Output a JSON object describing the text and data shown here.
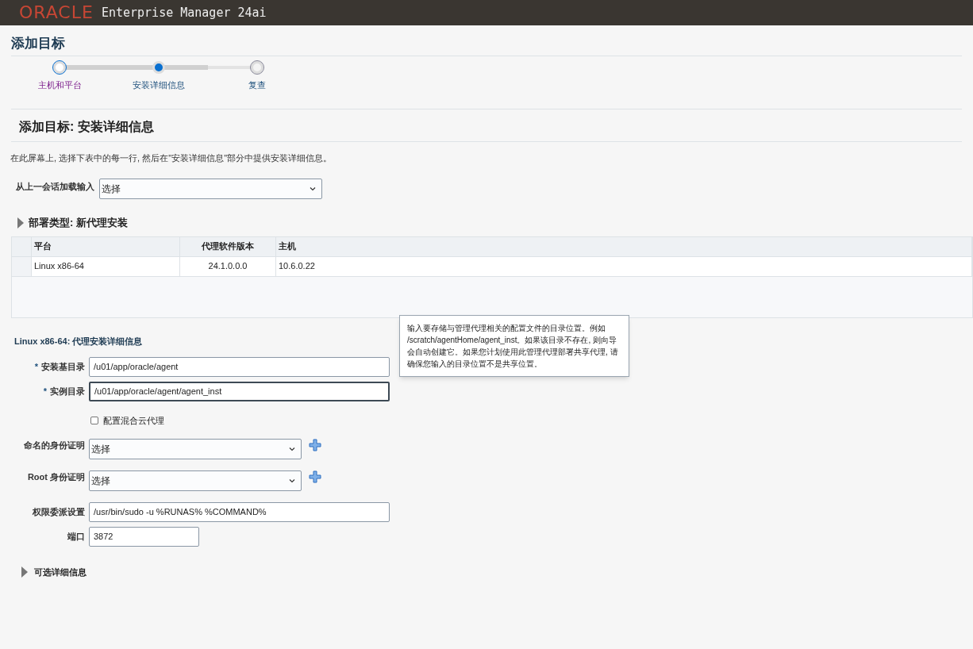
{
  "header": {
    "logo": "ORACLE",
    "product": "Enterprise Manager 24ai"
  },
  "page_title": "添加目标",
  "train": [
    {
      "label": "主机和平台",
      "selected": false,
      "visited": true
    },
    {
      "label": "安装详细信息",
      "selected": true,
      "visited": false
    },
    {
      "label": "复查",
      "selected": false,
      "visited": false
    }
  ],
  "section_title": "添加目标: 安装详细信息",
  "instructions": "在此屏幕上, 选择下表中的每一行, 然后在\"安装详细信息\"部分中提供安装详细信息。",
  "load_input": {
    "label": "从上一会话加载输入",
    "value": "选择"
  },
  "deployment": {
    "title": "部署类型: 新代理安装",
    "expanded": false
  },
  "table": {
    "columns": [
      "平台",
      "代理软件版本",
      "主机"
    ],
    "rows": [
      [
        "Linux x86-64",
        "24.1.0.0.0",
        "10.6.0.22"
      ]
    ]
  },
  "details_title": "Linux x86-64: 代理安装详细信息",
  "required_marker": "*",
  "fields": [
    {
      "kind": "input",
      "label": "安装基目录",
      "required": true,
      "value": "/u01/app/oracle/agent",
      "focused": false
    },
    {
      "kind": "input",
      "label": "实例目录",
      "required": true,
      "value": "/u01/app/oracle/agent/agent_inst",
      "focused": true
    },
    {
      "kind": "checkbox",
      "label": "配置混合云代理",
      "checked": false
    },
    {
      "kind": "select",
      "label": "命名的身份证明",
      "value": "选择",
      "add": true
    },
    {
      "kind": "select",
      "label": "Root 身份证明",
      "value": "选择",
      "add": true
    },
    {
      "kind": "input",
      "label": "权限委派设置",
      "value": "/usr/bin/sudo -u %RUNAS% %COMMAND%",
      "focused": false
    },
    {
      "kind": "short",
      "label": "端口",
      "value": "3872",
      "focused": false
    }
  ],
  "tooltip": "输入要存储与管理代理相关的配置文件的目录位置。例如 /scratch/agentHome/agent_inst。如果该目录不存在, 则向导会自动创建它。如果您计划使用此管理代理部署共享代理, 请确保您输入的目录位置不是共享位置。",
  "optional": {
    "title": "可选详细信息",
    "expanded": false
  }
}
